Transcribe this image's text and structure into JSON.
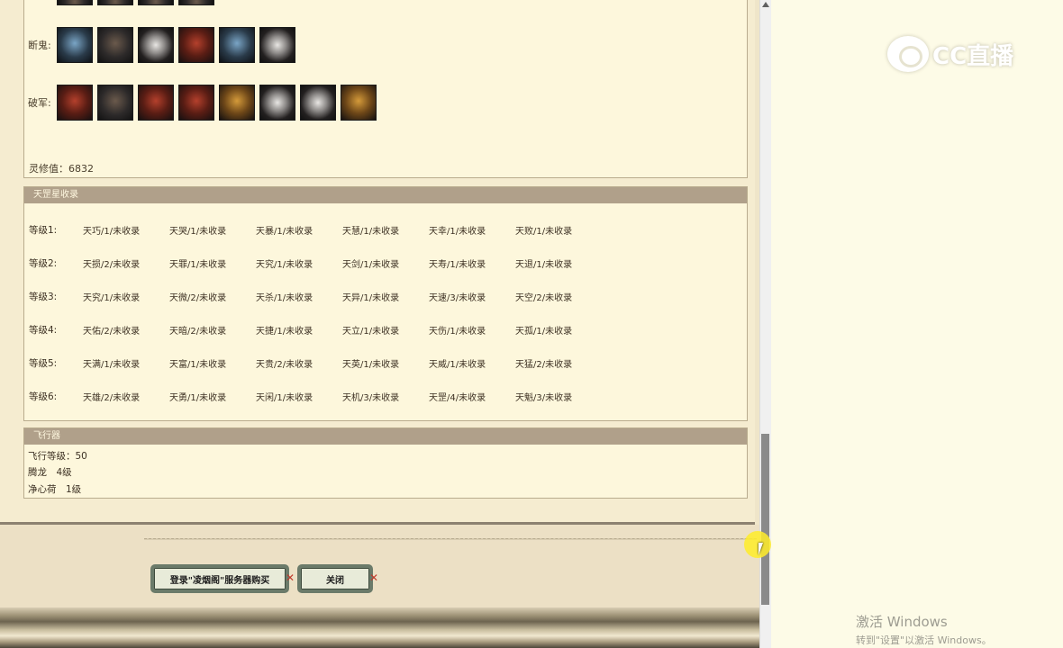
{
  "equipment": {
    "rows": [
      {
        "label": "",
        "slots": 4
      },
      {
        "label": "断鬼:",
        "slots": 6
      },
      {
        "label": "破军:",
        "slots": 8
      }
    ],
    "spirit_value": "灵修值：6832"
  },
  "star_collection": {
    "title": "天罡星收录",
    "grades": [
      {
        "label": "等级1:",
        "items": [
          "天巧/1/未收录",
          "天哭/1/未收录",
          "天暴/1/未收录",
          "天慧/1/未收录",
          "天幸/1/未收录",
          "天败/1/未收录"
        ]
      },
      {
        "label": "等级2:",
        "items": [
          "天损/2/未收录",
          "天罪/1/未收录",
          "天究/1/未收录",
          "天剑/1/未收录",
          "天寿/1/未收录",
          "天退/1/未收录"
        ]
      },
      {
        "label": "等级3:",
        "items": [
          "天究/1/未收录",
          "天微/2/未收录",
          "天杀/1/未收录",
          "天异/1/未收录",
          "天速/3/未收录",
          "天空/2/未收录"
        ]
      },
      {
        "label": "等级4:",
        "items": [
          "天佑/2/未收录",
          "天暗/2/未收录",
          "天捷/1/未收录",
          "天立/1/未收录",
          "天伤/1/未收录",
          "天孤/1/未收录"
        ]
      },
      {
        "label": "等级5:",
        "items": [
          "天满/1/未收录",
          "天富/1/未收录",
          "天贵/2/未收录",
          "天英/1/未收录",
          "天威/1/未收录",
          "天猛/2/未收录"
        ]
      },
      {
        "label": "等级6:",
        "items": [
          "天雄/2/未收录",
          "天勇/1/未收录",
          "天闲/1/未收录",
          "天机/3/未收录",
          "天罡/4/未收录",
          "天魁/3/未收录"
        ]
      }
    ]
  },
  "flight": {
    "title": "飞行器",
    "lines": [
      "飞行等级：50",
      "腾龙　4级",
      "净心荷　1级"
    ]
  },
  "buttons": {
    "buy_label": "登录\"凌烟阁\"服务器购买",
    "close_label": "关闭"
  },
  "watermarks": {
    "logo_text": "CC直播",
    "activate_line1": "激活 Windows",
    "activate_line2": "转到\"设置\"以激活 Windows。"
  },
  "colors": {
    "panel_header": "#b0a08a",
    "panel_bg": "#fdf7dc",
    "button_border": "#6b7b6a",
    "close_mark": "#c0392b"
  }
}
